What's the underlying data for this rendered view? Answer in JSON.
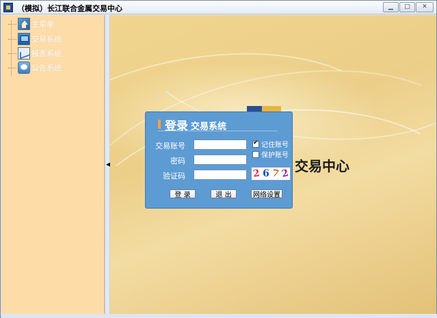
{
  "window": {
    "title": "（模拟）长江联合金属交易中心"
  },
  "sidebar": {
    "items": [
      {
        "label": "主菜单",
        "icon": "home-icon"
      },
      {
        "label": "交易系统",
        "icon": "monitor-icon"
      },
      {
        "label": "报表系统",
        "icon": "chart-icon"
      },
      {
        "label": "公告系统",
        "icon": "bubble-icon"
      }
    ]
  },
  "background": {
    "title": "交易中心"
  },
  "login": {
    "title_main": "登录",
    "title_sub": "交易系统",
    "account_label": "交易账号",
    "password_label": "密码",
    "captcha_label": "验证码",
    "account_value": "",
    "password_value": "",
    "captcha_value": "",
    "remember_label": "记住账号",
    "protect_label": "保护账号",
    "remember_checked": true,
    "protect_checked": false,
    "captcha_chars": [
      "2",
      "6",
      "7",
      "2"
    ],
    "login_button": "登 录",
    "exit_button": "退 出",
    "network_button": "网络设置"
  },
  "colors": {
    "dialog_bg": "#5d9bd3",
    "sidebar_bg": "#fddca8",
    "accent_bar": "#f4a436"
  }
}
